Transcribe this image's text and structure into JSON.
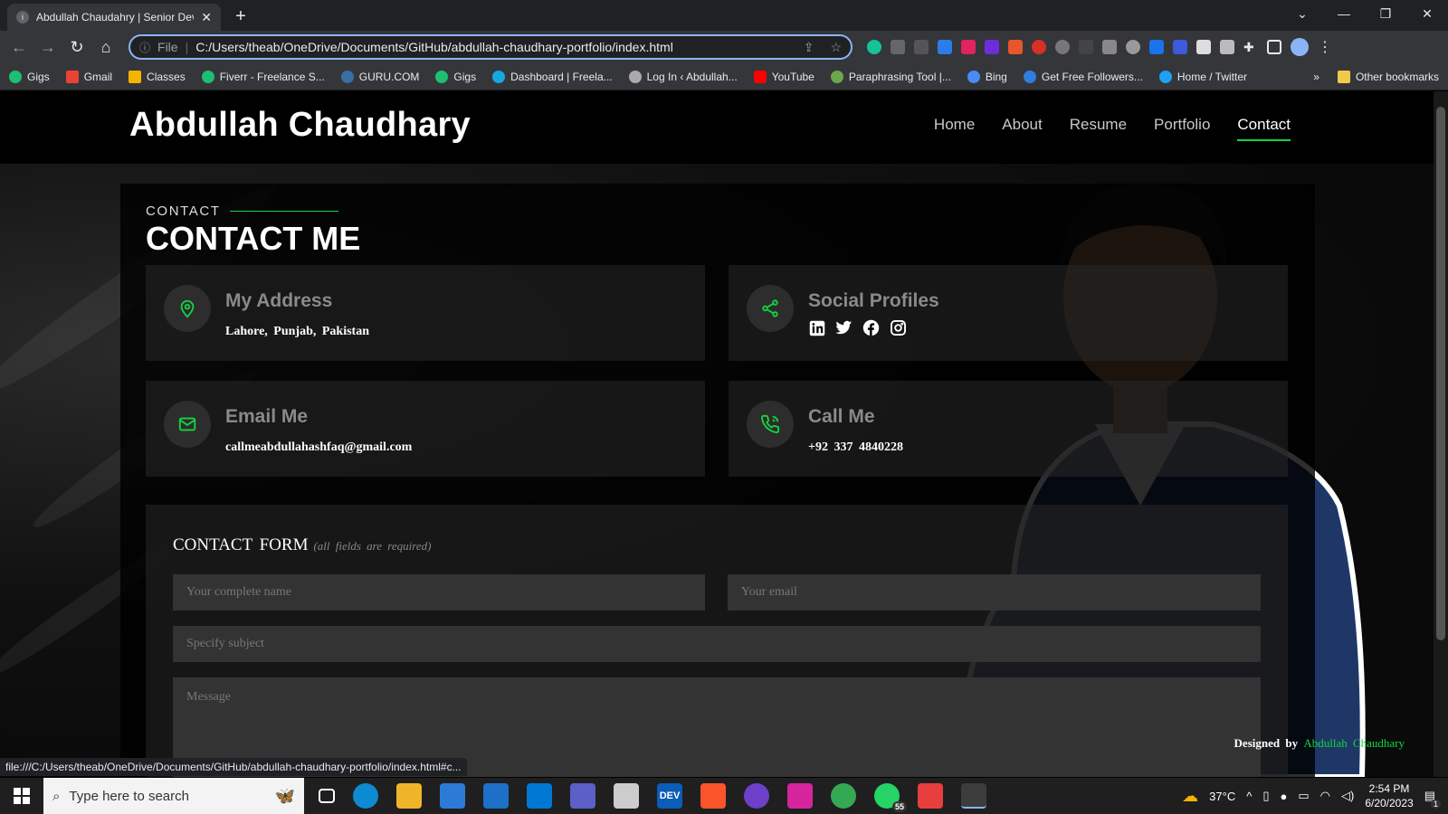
{
  "browser": {
    "tab_title": "Abdullah Chaudahry | Senior Dev",
    "address_prefix": "File",
    "url": "C:/Users/theab/OneDrive/Documents/GitHub/abdullah-chaudhary-portfolio/index.html",
    "status_url": "file:///C:/Users/theab/OneDrive/Documents/GitHub/abdullah-chaudhary-portfolio/index.html#c...",
    "bookmarks": [
      "Gigs",
      "Gmail",
      "Classes",
      "Fiverr - Freelance S...",
      "GURU.COM",
      "Gigs",
      "Dashboard | Freela...",
      "Log In ‹ Abdullah...",
      "YouTube",
      "Paraphrasing Tool |...",
      "Bing",
      "Get Free Followers...",
      "Home / Twitter"
    ],
    "other_bookmarks": "Other bookmarks"
  },
  "site": {
    "logo": "Abdullah Chaudhary",
    "nav": [
      "Home",
      "About",
      "Resume",
      "Portfolio",
      "Contact"
    ],
    "active_nav": "Contact",
    "accent": "#12d640"
  },
  "contact": {
    "label": "CONTACT",
    "title": "CONTACT ME",
    "address_title": "My Address",
    "address": "Lahore, Punjab, Pakistan",
    "social_title": "Social Profiles",
    "social_icons": [
      "linkedin-icon",
      "twitter-icon",
      "facebook-icon",
      "instagram-icon"
    ],
    "email_title": "Email Me",
    "email": "callmeabdullahashfaq@gmail.com",
    "call_title": "Call Me",
    "phone": "+92 337 4840228"
  },
  "form": {
    "title": "CONTACT FORM",
    "note": "(all fields are required)",
    "name_placeholder": "Your complete name",
    "email_placeholder": "Your email",
    "subject_placeholder": "Specify subject",
    "message_placeholder": "Message"
  },
  "footer": {
    "designed_by": "Designed by",
    "designer": "Abdullah Chaudhary"
  },
  "taskbar": {
    "search_placeholder": "Type here to search",
    "weather": "37°C",
    "time": "2:54 PM",
    "date": "6/20/2023",
    "whatsapp_badge": "55",
    "notif_badge": "1"
  }
}
